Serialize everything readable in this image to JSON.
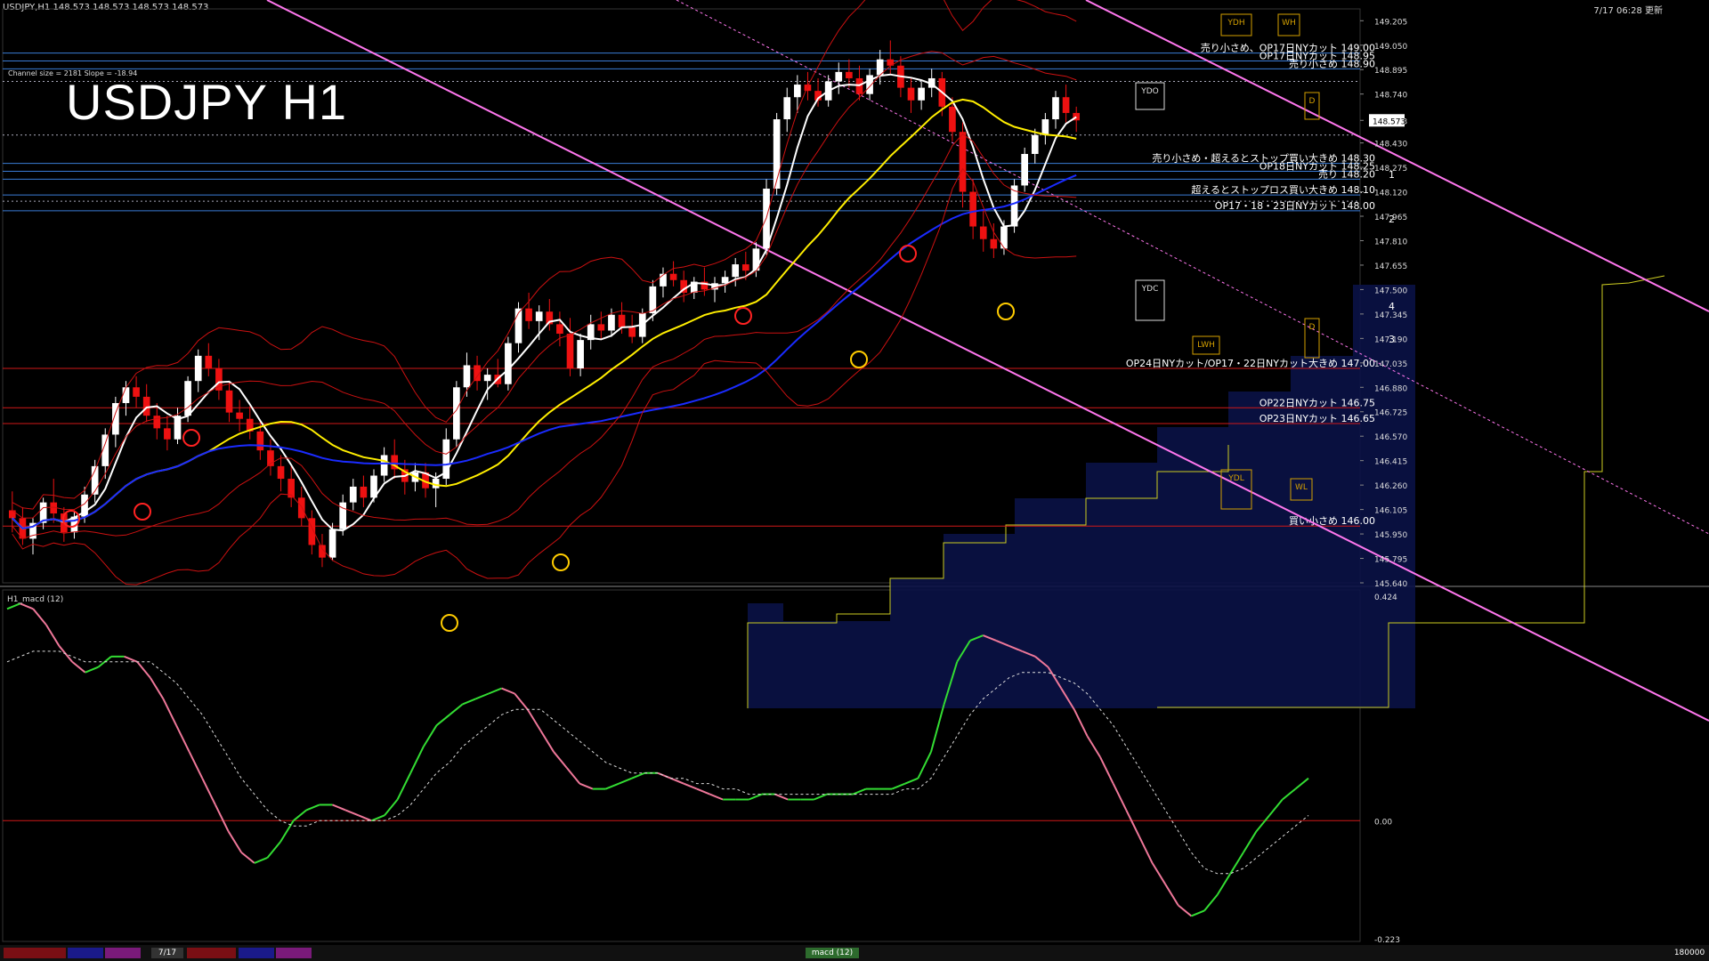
{
  "header": {
    "symbol_line": "USDJPY,H1  148.573 148.573 148.573 148.573",
    "datetime_label": "7/17 06:28 更新",
    "channel_info": "Channel size = 2181 Slope = -18.94",
    "big_title": "USDJPY H1"
  },
  "price_axis": {
    "ticks": [
      "149.205",
      "149.050",
      "148.895",
      "148.740",
      "148.573",
      "148.430",
      "148.275",
      "148.120",
      "147.965",
      "147.810",
      "147.655",
      "147.500",
      "147.345",
      "147.190",
      "147.035",
      "146.880",
      "146.725",
      "146.570",
      "146.415",
      "146.260",
      "146.105",
      "145.950",
      "145.795",
      "145.640"
    ],
    "current": "148.573"
  },
  "levels": [
    {
      "price": 149.0,
      "label": "売り小さめ、OP17日NYカット 149.00",
      "color": "#3a7bd5"
    },
    {
      "price": 148.95,
      "label": "OP17日NYカット 148.95",
      "color": "#3a7bd5"
    },
    {
      "price": 148.9,
      "label": "売り小さめ 148.90",
      "color": "#3a7bd5"
    },
    {
      "price": 148.3,
      "label": "売り小さめ・超えるとストップ買い大きめ 148.30",
      "color": "#3a7bd5"
    },
    {
      "price": 148.25,
      "label": "OP18日NYカット 148.25",
      "color": "#3a7bd5"
    },
    {
      "price": 148.2,
      "label": "売り 148.20",
      "color": "#3a7bd5"
    },
    {
      "price": 148.1,
      "label": "超えるとストップロス買い大きめ 148.10",
      "color": "#3a7bd5"
    },
    {
      "price": 148.0,
      "label": "OP17・18・23日NYカット 148.00",
      "color": "#3a7bd5"
    },
    {
      "price": 147.0,
      "label": "OP24日NYカット/OP17・22日NYカット大きめ 147.00",
      "color": "#d01818"
    },
    {
      "price": 146.75,
      "label": "OP22日NYカット 146.75",
      "color": "#d01818"
    },
    {
      "price": 146.65,
      "label": "OP23日NYカット 146.65",
      "color": "#d01818"
    },
    {
      "price": 146.0,
      "label": "買い小さめ 146.00",
      "color": "#d01818"
    }
  ],
  "markers": {
    "ydh": "YDH",
    "wh": "WH",
    "ydo": "YDO",
    "ydc": "YDC",
    "lwh": "LWH",
    "ydl": "YDL",
    "wl": "WL",
    "d_top": "D",
    "d_bot": "D"
  },
  "wave_labels": [
    "1",
    "2",
    "4",
    "3"
  ],
  "macd": {
    "title": "H1_macd (12)",
    "ticks": [
      "0.424",
      "0.00",
      "-0.223"
    ],
    "max": 0.424,
    "min": -0.223
  },
  "tabs": {
    "date": "7/17",
    "indicator": "macd (12)",
    "right": "180000"
  },
  "colors": {
    "up": "#ffffff",
    "down": "#ee1111",
    "ma_fast": "#ffffff",
    "ma_mid": "#ffee00",
    "ma_slow": "#1a2bff",
    "bb": "#cc1111",
    "green": "#22cc22",
    "channel": "#ff77ee",
    "cloud": "#2233cc"
  },
  "chart_data": {
    "type": "candlestick",
    "ylim": [
      145.64,
      149.28
    ],
    "ohlc": [
      [
        146.1,
        146.22,
        145.96,
        146.05
      ],
      [
        146.05,
        146.12,
        145.88,
        145.92
      ],
      [
        145.92,
        146.05,
        145.82,
        146.02
      ],
      [
        146.02,
        146.18,
        145.98,
        146.15
      ],
      [
        146.15,
        146.3,
        146.02,
        146.08
      ],
      [
        146.08,
        146.12,
        145.9,
        145.96
      ],
      [
        145.96,
        146.1,
        145.92,
        146.06
      ],
      [
        146.06,
        146.25,
        146.02,
        146.2
      ],
      [
        146.2,
        146.42,
        146.15,
        146.38
      ],
      [
        146.38,
        146.62,
        146.3,
        146.58
      ],
      [
        146.58,
        146.82,
        146.5,
        146.78
      ],
      [
        146.78,
        146.92,
        146.7,
        146.88
      ],
      [
        146.88,
        146.95,
        146.75,
        146.82
      ],
      [
        146.82,
        146.9,
        146.66,
        146.7
      ],
      [
        146.7,
        146.78,
        146.55,
        146.62
      ],
      [
        146.62,
        146.7,
        146.48,
        146.55
      ],
      [
        146.55,
        146.75,
        146.52,
        146.7
      ],
      [
        146.7,
        146.95,
        146.66,
        146.92
      ],
      [
        146.92,
        147.12,
        146.85,
        147.08
      ],
      [
        147.08,
        147.16,
        146.95,
        147.0
      ],
      [
        147.0,
        147.06,
        146.8,
        146.86
      ],
      [
        146.86,
        146.92,
        146.66,
        146.72
      ],
      [
        146.72,
        146.8,
        146.6,
        146.68
      ],
      [
        146.68,
        146.76,
        146.55,
        146.6
      ],
      [
        146.6,
        146.66,
        146.42,
        146.48
      ],
      [
        146.48,
        146.55,
        146.32,
        146.38
      ],
      [
        146.38,
        146.45,
        146.22,
        146.3
      ],
      [
        146.3,
        146.38,
        146.12,
        146.18
      ],
      [
        146.18,
        146.25,
        146.0,
        146.05
      ],
      [
        146.05,
        146.1,
        145.82,
        145.88
      ],
      [
        145.88,
        145.95,
        145.74,
        145.8
      ],
      [
        145.8,
        146.02,
        145.78,
        145.98
      ],
      [
        145.98,
        146.2,
        145.94,
        146.15
      ],
      [
        146.15,
        146.3,
        146.1,
        146.25
      ],
      [
        146.25,
        146.32,
        146.12,
        146.18
      ],
      [
        146.18,
        146.36,
        146.15,
        146.32
      ],
      [
        146.32,
        146.5,
        146.28,
        146.45
      ],
      [
        146.45,
        146.55,
        146.3,
        146.36
      ],
      [
        146.36,
        146.42,
        146.2,
        146.28
      ],
      [
        146.28,
        146.4,
        146.22,
        146.34
      ],
      [
        146.34,
        146.4,
        146.18,
        146.24
      ],
      [
        146.24,
        146.34,
        146.12,
        146.3
      ],
      [
        146.3,
        146.62,
        146.26,
        146.55
      ],
      [
        146.55,
        146.92,
        146.5,
        146.88
      ],
      [
        146.88,
        147.1,
        146.82,
        147.02
      ],
      [
        147.02,
        147.08,
        146.86,
        146.92
      ],
      [
        146.92,
        147.0,
        146.8,
        146.96
      ],
      [
        146.96,
        147.06,
        146.88,
        146.9
      ],
      [
        146.9,
        147.2,
        146.86,
        147.16
      ],
      [
        147.16,
        147.42,
        147.1,
        147.38
      ],
      [
        147.38,
        147.48,
        147.25,
        147.3
      ],
      [
        147.3,
        147.4,
        147.18,
        147.36
      ],
      [
        147.36,
        147.44,
        147.24,
        147.28
      ],
      [
        147.28,
        147.36,
        147.14,
        147.22
      ],
      [
        147.22,
        147.32,
        146.95,
        147.0
      ],
      [
        147.0,
        147.22,
        146.95,
        147.18
      ],
      [
        147.18,
        147.34,
        147.12,
        147.28
      ],
      [
        147.28,
        147.36,
        147.18,
        147.24
      ],
      [
        147.24,
        147.38,
        147.2,
        147.34
      ],
      [
        147.34,
        147.42,
        147.22,
        147.26
      ],
      [
        147.26,
        147.34,
        147.16,
        147.2
      ],
      [
        147.2,
        147.38,
        147.16,
        147.35
      ],
      [
        147.35,
        147.56,
        147.3,
        147.52
      ],
      [
        147.52,
        147.64,
        147.45,
        147.6
      ],
      [
        147.6,
        147.68,
        147.52,
        147.56
      ],
      [
        147.56,
        147.62,
        147.42,
        147.48
      ],
      [
        147.48,
        147.58,
        147.44,
        147.55
      ],
      [
        147.55,
        147.64,
        147.46,
        147.5
      ],
      [
        147.5,
        147.58,
        147.42,
        147.54
      ],
      [
        147.54,
        147.62,
        147.48,
        147.58
      ],
      [
        147.58,
        147.7,
        147.52,
        147.66
      ],
      [
        147.66,
        147.74,
        147.56,
        147.62
      ],
      [
        147.62,
        147.8,
        147.58,
        147.76
      ],
      [
        147.76,
        148.2,
        147.72,
        148.14
      ],
      [
        148.14,
        148.62,
        148.1,
        148.58
      ],
      [
        148.58,
        148.78,
        148.5,
        148.72
      ],
      [
        148.72,
        148.86,
        148.62,
        148.8
      ],
      [
        148.8,
        148.88,
        148.7,
        148.76
      ],
      [
        148.76,
        148.84,
        148.66,
        148.7
      ],
      [
        148.7,
        148.86,
        148.66,
        148.82
      ],
      [
        148.82,
        148.94,
        148.74,
        148.88
      ],
      [
        148.88,
        148.96,
        148.78,
        148.84
      ],
      [
        148.84,
        148.92,
        148.7,
        148.74
      ],
      [
        148.74,
        148.9,
        148.7,
        148.86
      ],
      [
        148.86,
        149.02,
        148.8,
        148.96
      ],
      [
        148.96,
        149.08,
        148.86,
        148.92
      ],
      [
        148.92,
        148.98,
        148.72,
        148.78
      ],
      [
        148.78,
        148.84,
        148.62,
        148.7
      ],
      [
        148.7,
        148.82,
        148.64,
        148.78
      ],
      [
        148.78,
        148.9,
        148.72,
        148.84
      ],
      [
        148.84,
        148.88,
        148.6,
        148.66
      ],
      [
        148.66,
        148.72,
        148.44,
        148.5
      ],
      [
        148.5,
        148.56,
        148.02,
        148.12
      ],
      [
        148.12,
        148.2,
        147.82,
        147.9
      ],
      [
        147.9,
        148.0,
        147.74,
        147.82
      ],
      [
        147.82,
        147.92,
        147.7,
        147.76
      ],
      [
        147.76,
        147.94,
        147.72,
        147.9
      ],
      [
        147.9,
        148.2,
        147.86,
        148.16
      ],
      [
        148.16,
        148.4,
        148.12,
        148.36
      ],
      [
        148.36,
        148.52,
        148.3,
        148.48
      ],
      [
        148.48,
        148.62,
        148.42,
        148.58
      ],
      [
        148.58,
        148.76,
        148.52,
        148.72
      ],
      [
        148.72,
        148.8,
        148.56,
        148.62
      ],
      [
        148.62,
        148.66,
        148.5,
        148.573
      ]
    ],
    "macd_line": [
      0.4,
      0.41,
      0.4,
      0.37,
      0.33,
      0.3,
      0.28,
      0.29,
      0.31,
      0.31,
      0.3,
      0.27,
      0.23,
      0.18,
      0.13,
      0.08,
      0.03,
      -0.02,
      -0.06,
      -0.08,
      -0.07,
      -0.04,
      0.0,
      0.02,
      0.03,
      0.03,
      0.02,
      0.01,
      0.0,
      0.01,
      0.04,
      0.09,
      0.14,
      0.18,
      0.2,
      0.22,
      0.23,
      0.24,
      0.25,
      0.24,
      0.21,
      0.17,
      0.13,
      0.1,
      0.07,
      0.06,
      0.06,
      0.07,
      0.08,
      0.09,
      0.09,
      0.08,
      0.07,
      0.06,
      0.05,
      0.04,
      0.04,
      0.04,
      0.05,
      0.05,
      0.04,
      0.04,
      0.04,
      0.05,
      0.05,
      0.05,
      0.06,
      0.06,
      0.06,
      0.07,
      0.08,
      0.13,
      0.22,
      0.3,
      0.34,
      0.35,
      0.34,
      0.33,
      0.32,
      0.31,
      0.29,
      0.25,
      0.21,
      0.16,
      0.12,
      0.07,
      0.02,
      -0.03,
      -0.08,
      -0.12,
      -0.16,
      -0.18,
      -0.17,
      -0.14,
      -0.1,
      -0.06,
      -0.02,
      0.01,
      0.04,
      0.06,
      0.08
    ],
    "signal_line": [
      0.3,
      0.31,
      0.32,
      0.32,
      0.32,
      0.31,
      0.3,
      0.3,
      0.3,
      0.3,
      0.3,
      0.3,
      0.28,
      0.26,
      0.23,
      0.2,
      0.16,
      0.12,
      0.08,
      0.05,
      0.02,
      0.0,
      -0.01,
      -0.01,
      0.0,
      0.0,
      0.0,
      0.0,
      0.0,
      0.0,
      0.01,
      0.03,
      0.06,
      0.09,
      0.11,
      0.14,
      0.16,
      0.18,
      0.2,
      0.21,
      0.21,
      0.21,
      0.19,
      0.17,
      0.15,
      0.13,
      0.11,
      0.1,
      0.09,
      0.09,
      0.09,
      0.08,
      0.08,
      0.07,
      0.07,
      0.06,
      0.06,
      0.05,
      0.05,
      0.05,
      0.05,
      0.05,
      0.05,
      0.05,
      0.05,
      0.05,
      0.05,
      0.05,
      0.05,
      0.06,
      0.06,
      0.08,
      0.12,
      0.16,
      0.2,
      0.23,
      0.25,
      0.27,
      0.28,
      0.28,
      0.28,
      0.27,
      0.26,
      0.24,
      0.21,
      0.18,
      0.14,
      0.1,
      0.06,
      0.02,
      -0.02,
      -0.06,
      -0.09,
      -0.1,
      -0.1,
      -0.09,
      -0.07,
      -0.05,
      -0.03,
      -0.01,
      0.01
    ]
  }
}
